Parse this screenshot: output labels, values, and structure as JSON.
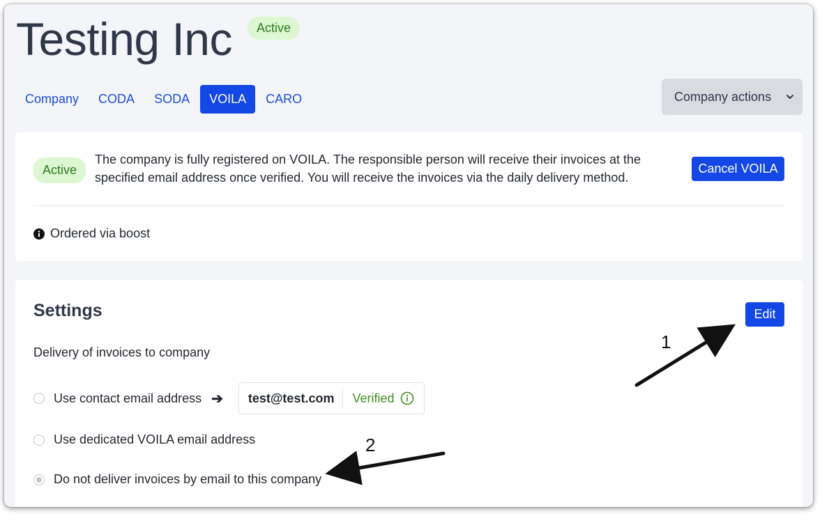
{
  "header": {
    "title": "Testing Inc",
    "status_badge": "Active"
  },
  "tabs": [
    {
      "label": "Company",
      "active": false
    },
    {
      "label": "CODA",
      "active": false
    },
    {
      "label": "SODA",
      "active": false
    },
    {
      "label": "VOILA",
      "active": true
    },
    {
      "label": "CARO",
      "active": false
    }
  ],
  "company_actions": {
    "label": "Company actions",
    "icon": "chevron-down-icon"
  },
  "registration": {
    "status_badge": "Active",
    "message": "The company is fully registered on VOILA. The responsible person will receive their invoices at the specified email address once verified. You will receive the invoices via the daily delivery method.",
    "cancel_label": "Cancel VOILA",
    "info_icon": "info-circle-icon",
    "ordered_text": "Ordered via boost"
  },
  "settings": {
    "title": "Settings",
    "edit_label": "Edit",
    "delivery_label": "Delivery of invoices to company",
    "options": [
      {
        "label": "Use contact email address",
        "selected": false
      },
      {
        "label": "Use dedicated VOILA email address",
        "selected": false
      },
      {
        "label": "Do not deliver invoices by email to this company",
        "selected": true
      }
    ],
    "contact_email": "test@test.com",
    "verified_label": "Verified"
  },
  "annotations": {
    "one": "1",
    "two": "2"
  },
  "colors": {
    "accent": "#1347e6",
    "badge_bg": "#dcf7d2",
    "badge_text": "#2f7a1f",
    "verified": "#3f8f22"
  }
}
